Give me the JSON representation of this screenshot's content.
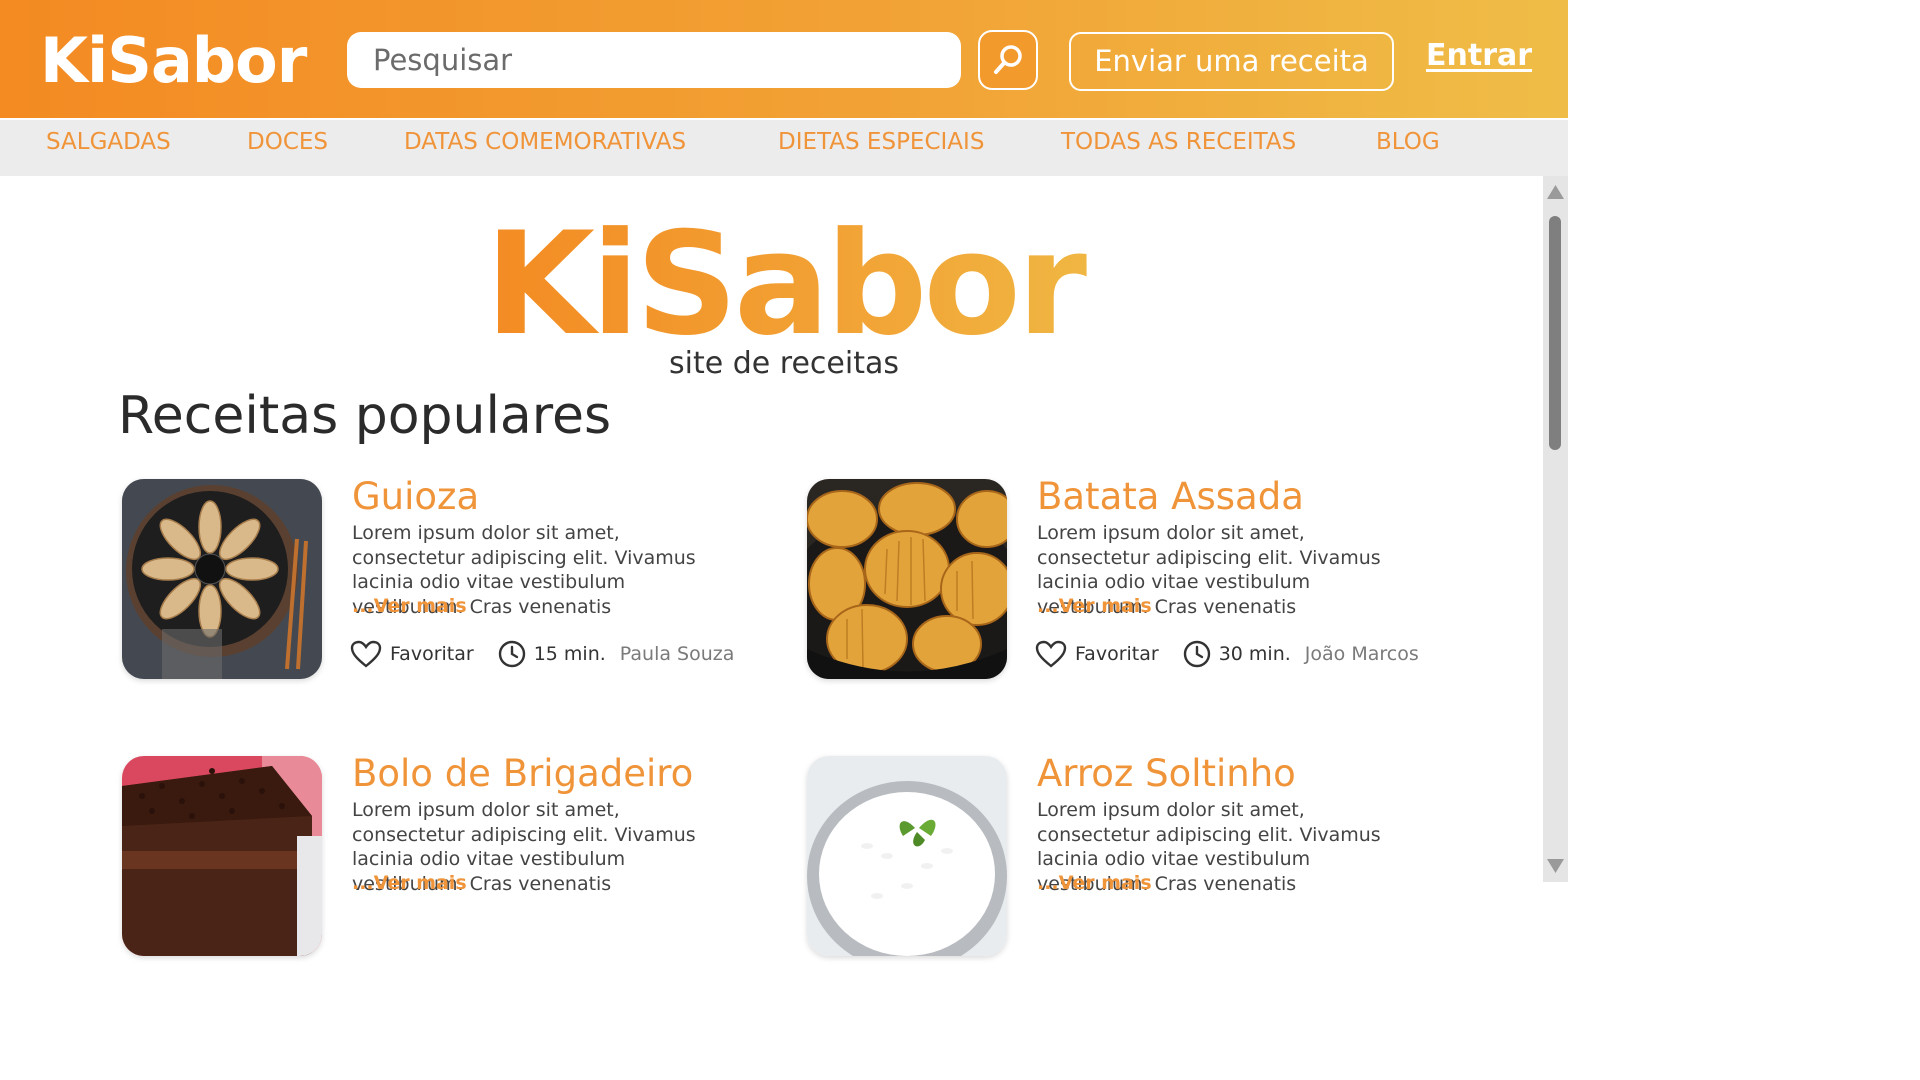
{
  "header": {
    "logo": "KiSabor",
    "search_placeholder": "Pesquisar",
    "submit_recipe_label": "Enviar uma receita",
    "login_label": "Entrar"
  },
  "nav": {
    "items": [
      {
        "label": "SALGADAS"
      },
      {
        "label": "DOCES"
      },
      {
        "label": "DATAS COMEMORATIVAS"
      },
      {
        "label": "DIETAS ESPECIAIS"
      },
      {
        "label": "TODAS AS RECEITAS"
      },
      {
        "label": "BLOG"
      }
    ]
  },
  "hero": {
    "logo": "KiSabor",
    "subtitle": "site de receitas"
  },
  "section": {
    "title": "Receitas populares"
  },
  "recipes": [
    {
      "title": "Guioza",
      "description": "Lorem ipsum dolor sit amet, consectetur adipiscing elit. Vivamus lacinia odio vitae vestibulum vestibulum. Cras venenatis",
      "more": "...Ver mais",
      "favorite": "Favoritar",
      "time": "15 min.",
      "author": "Paula Souza"
    },
    {
      "title": "Batata Assada",
      "description": "Lorem ipsum dolor sit amet, consectetur adipiscing elit. Vivamus lacinia odio vitae vestibulum vestibulum. Cras venenatis",
      "more": "...Ver mais",
      "favorite": "Favoritar",
      "time": "30 min.",
      "author": "João Marcos"
    },
    {
      "title": "Bolo de Brigadeiro",
      "description": "Lorem ipsum dolor sit amet, consectetur adipiscing elit. Vivamus lacinia odio vitae vestibulum vestibulum. Cras venenatis",
      "more": "...Ver mais"
    },
    {
      "title": "Arroz Soltinho",
      "description": "Lorem ipsum dolor sit amet, consectetur adipiscing elit. Vivamus lacinia odio vitae vestibulum vestibulum. Cras venenatis",
      "more": "...Ver mais"
    }
  ],
  "icons": {
    "search": "search-icon",
    "heart": "heart-icon",
    "clock": "clock-icon"
  },
  "colors": {
    "brand_orange": "#f38a22",
    "brand_yellow": "#efbd47",
    "accent_text": "#f0943a",
    "nav_bg": "#ececec"
  }
}
